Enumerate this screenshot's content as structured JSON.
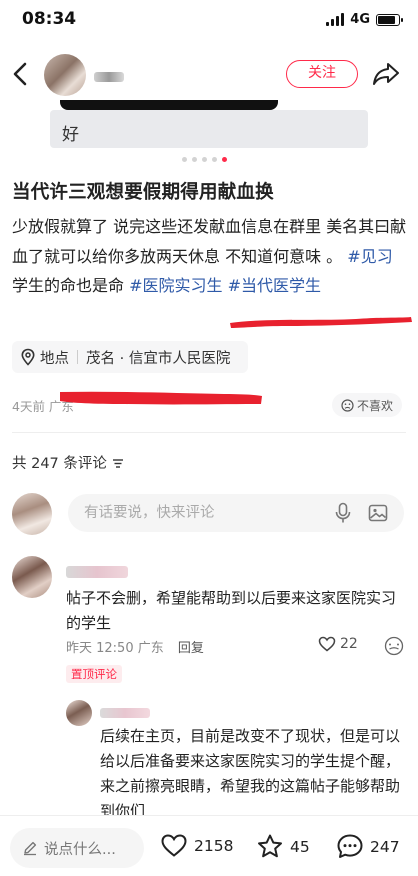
{
  "status_bar": {
    "time": "08:34",
    "network": "4G",
    "battery_level": 0.85
  },
  "header": {
    "follow_label": "关注"
  },
  "post": {
    "image_text": "好",
    "carousel": {
      "count": 5,
      "active_index": 4
    },
    "title": "当代许三观想要假期得用献血换",
    "body_text": "少放假就算了 说完这些还发献血信息在群里 美名其曰献血了就可以给你多放两天休息 不知道何意味 。",
    "hashtag_1": "#见习",
    "body_mid": " 学生的命也是命",
    "hashtag_2": "#医院实习生",
    "hashtag_3": " #当代医学生",
    "location_label": "地点",
    "location_name": "茂名 · 信宜市人民医院",
    "meta": "4天前 广东",
    "dislike_label": "不喜欢"
  },
  "comments_section": {
    "count_label": "共 247 条评论",
    "compose_placeholder": "有话要说，快来评论"
  },
  "comment_1": {
    "text": "帖子不会删，希望能帮助到以后要来这家医院实习的学生",
    "time": "昨天 12:50 广东",
    "reply_label": "回复",
    "likes": "22",
    "badge": "置顶评论"
  },
  "reply_1": {
    "text": "后续在主页，目前是改变不了现状，但是可以给以后准备要来这家医院实习的学生提个醒，来之前擦亮眼睛，希望我的这篇帖子能够帮助到你们"
  },
  "bottom_bar": {
    "input_placeholder": "说点什么...",
    "likes": "2158",
    "favorites": "45",
    "comments": "247"
  },
  "colors": {
    "accent": "#ff2a4a",
    "hashtag": "#2f5aa8",
    "scribble": "#e8212e"
  },
  "icons": [
    "back-icon",
    "share-icon",
    "location-pin-icon",
    "dislike-icon",
    "sort-icon",
    "mic-icon",
    "image-icon",
    "heart-icon",
    "more-icon",
    "pencil-icon",
    "star-icon",
    "chat-icon"
  ]
}
